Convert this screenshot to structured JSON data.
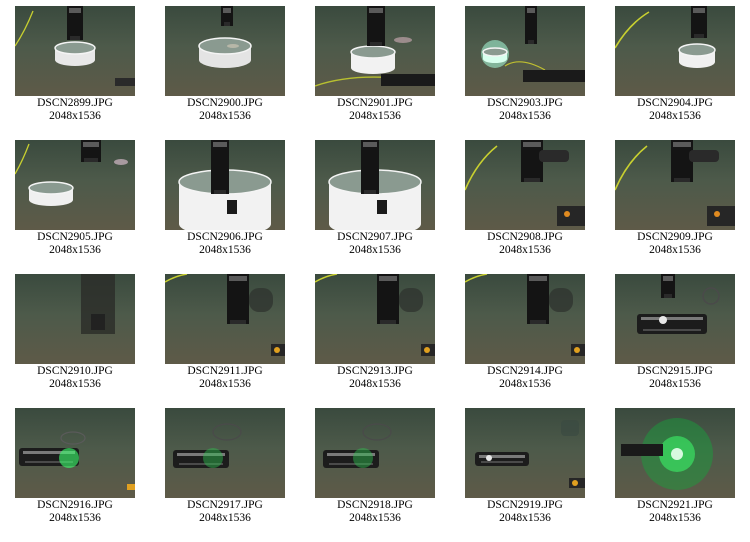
{
  "gallery": {
    "background_color": "#ffffff",
    "items": [
      {
        "filename": "DSCN2899.JPG",
        "dimensions": "2048x1536",
        "scene": "ring-small"
      },
      {
        "filename": "DSCN2900.JPG",
        "dimensions": "2048x1536",
        "scene": "ring-fish"
      },
      {
        "filename": "DSCN2901.JPG",
        "dimensions": "2048x1536",
        "scene": "ring-dark"
      },
      {
        "filename": "DSCN2903.JPG",
        "dimensions": "2048x1536",
        "scene": "ring-green"
      },
      {
        "filename": "DSCN2904.JPG",
        "dimensions": "2048x1536",
        "scene": "ring-right"
      },
      {
        "filename": "DSCN2905.JPG",
        "dimensions": "2048x1536",
        "scene": "ring-left"
      },
      {
        "filename": "DSCN2906.JPG",
        "dimensions": "2048x1536",
        "scene": "ring-large"
      },
      {
        "filename": "DSCN2907.JPG",
        "dimensions": "2048x1536",
        "scene": "ring-large"
      },
      {
        "filename": "DSCN2908.JPG",
        "dimensions": "2048x1536",
        "scene": "arm-cable"
      },
      {
        "filename": "DSCN2909.JPG",
        "dimensions": "2048x1536",
        "scene": "arm-cable"
      },
      {
        "filename": "DSCN2910.JPG",
        "dimensions": "2048x1536",
        "scene": "murky"
      },
      {
        "filename": "DSCN2911.JPG",
        "dimensions": "2048x1536",
        "scene": "arm-seafloor"
      },
      {
        "filename": "DSCN2913.JPG",
        "dimensions": "2048x1536",
        "scene": "arm-seafloor"
      },
      {
        "filename": "DSCN2914.JPG",
        "dimensions": "2048x1536",
        "scene": "arm-seafloor"
      },
      {
        "filename": "DSCN2915.JPG",
        "dimensions": "2048x1536",
        "scene": "camera-housing"
      },
      {
        "filename": "DSCN2916.JPG",
        "dimensions": "2048x1536",
        "scene": "green-laser"
      },
      {
        "filename": "DSCN2917.JPG",
        "dimensions": "2048x1536",
        "scene": "green-laser-dim"
      },
      {
        "filename": "DSCN2918.JPG",
        "dimensions": "2048x1536",
        "scene": "green-laser-dim"
      },
      {
        "filename": "DSCN2919.JPG",
        "dimensions": "2048x1536",
        "scene": "camera-seafloor"
      },
      {
        "filename": "DSCN2921.JPG",
        "dimensions": "2048x1536",
        "scene": "green-bright"
      }
    ]
  }
}
